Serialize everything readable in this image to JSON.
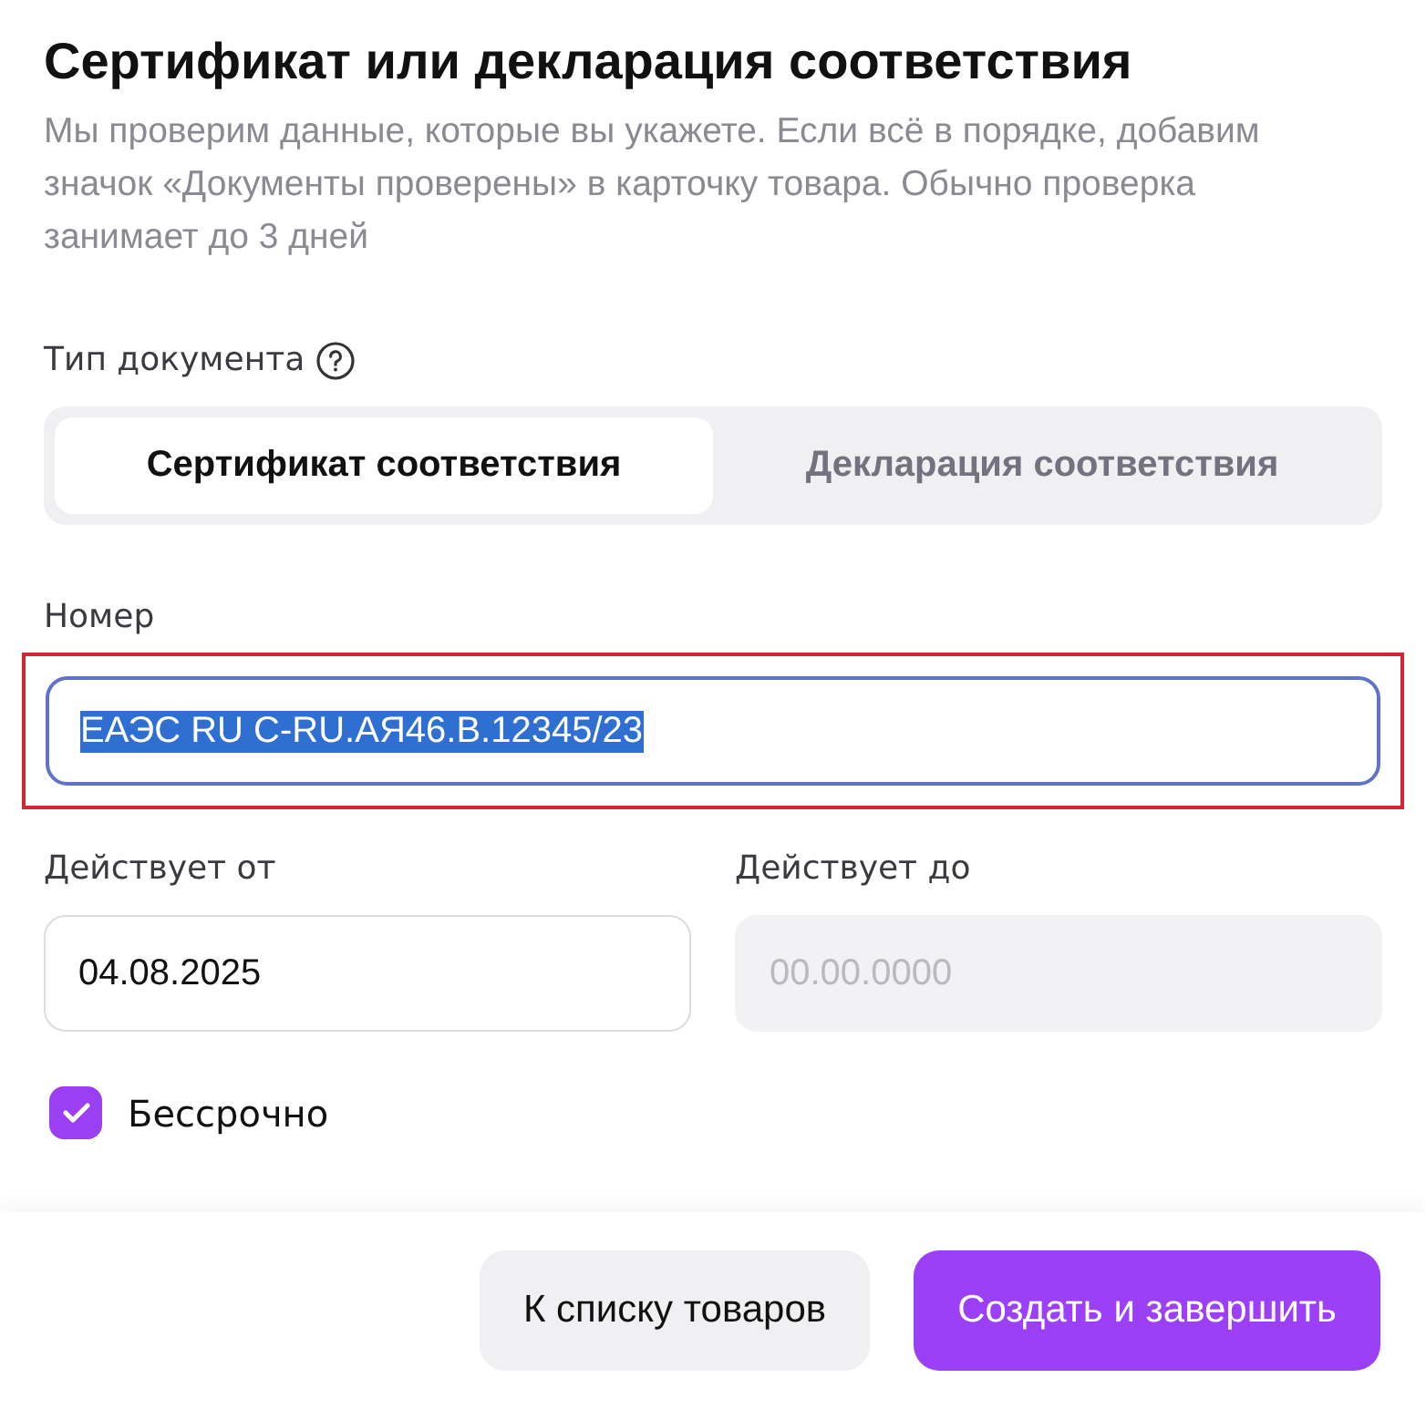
{
  "title": "Сертификат или декларация соответствия",
  "description": "Мы проверим данные, которые вы укажете. Если всё в порядке, добавим значок «Документы проверены» в карточку товара. Обычно проверка занимает до 3 дней",
  "document_type": {
    "label": "Тип документа",
    "options": [
      {
        "label": "Сертификат соответствия",
        "selected": true
      },
      {
        "label": "Декларация соответствия",
        "selected": false
      }
    ]
  },
  "number": {
    "label": "Номер",
    "value": "ЕАЭС RU C-RU.АЯ46.В.12345/23",
    "text_selected": true,
    "highlighted": true
  },
  "valid_from": {
    "label": "Действует от",
    "value": "04.08.2025",
    "disabled": false
  },
  "valid_to": {
    "label": "Действует до",
    "placeholder": "00.00.0000",
    "disabled": true
  },
  "unlimited": {
    "label": "Бессрочно",
    "checked": true
  },
  "buttons": [
    {
      "label": "К списку товаров",
      "kind": "secondary"
    },
    {
      "label": "Создать и завершить",
      "kind": "primary"
    }
  ]
}
